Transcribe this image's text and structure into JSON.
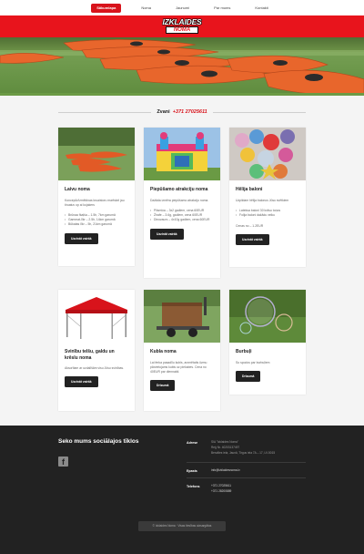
{
  "nav": {
    "items": [
      {
        "label": "Sākumlapa",
        "active": true
      },
      {
        "label": "Noma",
        "active": false
      },
      {
        "label": "Jaunumi",
        "active": false
      },
      {
        "label": "Par mums",
        "active": false
      },
      {
        "label": "Kontakti",
        "active": false
      }
    ]
  },
  "logo": {
    "line1": "IZKLAIDES",
    "line2": "NOMA"
  },
  "contact_bar": {
    "label": "Zvani",
    "phone": "+371 27025611"
  },
  "cards": [
    {
      "title": "Laivu noma",
      "desc": "Koncepūr/izmēklnas kruaistoru marfskel jau tiruatuv op ai kojakers",
      "bullets": [
        "Brūnaa fkaļša – 1.5h, 7km garumā",
        "Gammat-līkr – 2.5h, 14km garumā",
        "Būkatas līkr – 5h, 21km garumā"
      ],
      "button": "Uzzināt vairāk"
    },
    {
      "title": "Piepūšamo atrakciju noma",
      "desc": "Dažāda izmēra piepūšamo atrakciju noma.",
      "bullets": [
        "Pilsmiņa – 3x2 gadlem, cena 60EUR",
        "Žirafe – 3.6g, gadlem, cena 60EUR",
        "Dinozaurs – 4x10g gadlem, cena 60EUR"
      ],
      "button": "Uzzināt vairāk"
    },
    {
      "title": "Hēlija baloni",
      "desc": "Uzpildam hēlija balonus Jūsu svētkiem",
      "bullets": [
        "Lateksa baloni 30 krāsu toņos",
        "Folija baloni dažādu veiku"
      ],
      "note": "Cenas no – 1.2EUR",
      "button": "Uzzināt vairāk"
    },
    {
      "title": "Svinību telšu, galdu un krēslu noma",
      "desc": "Aksorītam ar uzdalīšām visu Jūsu svinības.",
      "bullets": [],
      "button": "Uzzināt vairāk"
    },
    {
      "title": "Kubla noma",
      "desc": "Lai ferka pasadīlu kubls, arzmētatis ūzmu pārvietojams kubls uz piekabes. Cena no 40EUR par diennakti.",
      "bullets": [],
      "button": "Drīzumā"
    },
    {
      "title": "Burbuļi",
      "desc": "So spodcs par burbuļiem",
      "bullets": [],
      "button": "Drīzumā"
    }
  ],
  "footer": {
    "social_title": "Seko mums sociālajos tīklos",
    "address_label": "Adrese",
    "address_lines": [
      "SIA \"Izklaides Noma\"",
      "Reģ Nr. 40203137497",
      "Berzāles iela, Jaunā, Tirgus iela 7A – 17, LV-5015"
    ],
    "email_label": "Epasts",
    "email": "info@izklaidesnoma.lv",
    "phone_label": "Telefons",
    "phones": [
      "+371 27025611",
      "+371 28200889"
    ],
    "copyright": "© Izklaides Noma · Visas tiesības aizsargātas"
  },
  "colors": {
    "accent": "#d8131b",
    "footer_bg": "#222222",
    "page_bg": "#f4f4f4"
  },
  "icons": {
    "social": "facebook-icon"
  }
}
